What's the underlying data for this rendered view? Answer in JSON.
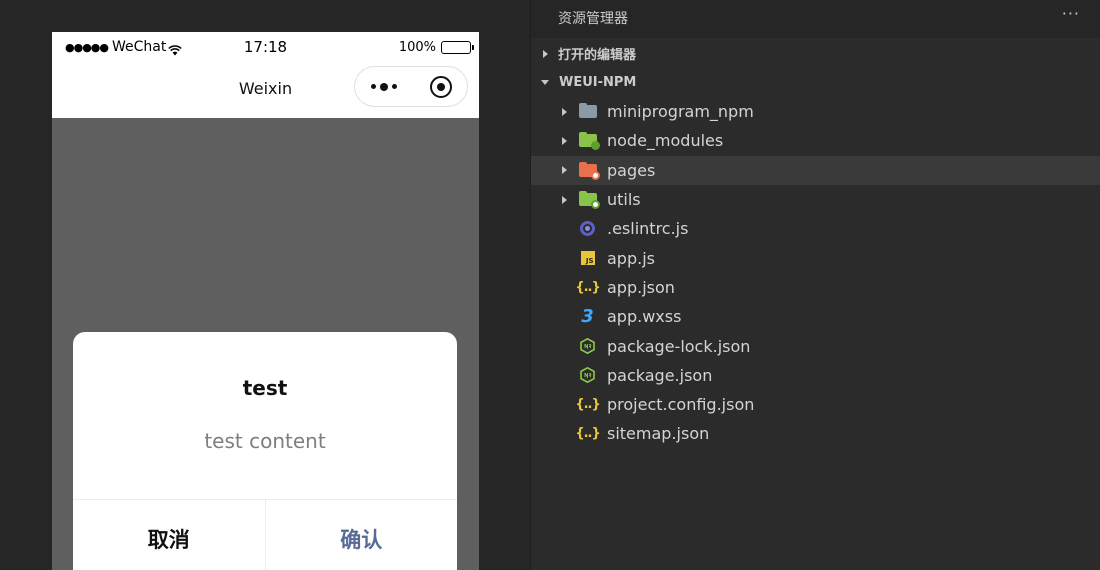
{
  "simulator": {
    "status_bar": {
      "signal_dots": "●●●●●",
      "carrier": "WeChat",
      "time": "17:18",
      "battery_percent": "100%"
    },
    "nav_title": "Weixin",
    "dialog": {
      "title": "test",
      "content": "test content",
      "cancel_label": "取消",
      "confirm_label": "确认"
    }
  },
  "explorer": {
    "title": "资源管理器",
    "more_label": "···",
    "open_editors_label": "打开的编辑器",
    "project_label": "WEUI-NPM",
    "items": [
      {
        "name": "miniprogram_npm",
        "kind": "folder",
        "icon": "folder-gray-icon"
      },
      {
        "name": "node_modules",
        "kind": "folder",
        "icon": "folder-node-icon"
      },
      {
        "name": "pages",
        "kind": "folder",
        "icon": "folder-pages-icon"
      },
      {
        "name": "utils",
        "kind": "folder",
        "icon": "folder-utils-icon"
      },
      {
        "name": ".eslintrc.js",
        "kind": "file",
        "icon": "eslint-icon"
      },
      {
        "name": "app.js",
        "kind": "file",
        "icon": "js-file-icon"
      },
      {
        "name": "app.json",
        "kind": "file",
        "icon": "json-file-icon"
      },
      {
        "name": "app.wxss",
        "kind": "file",
        "icon": "css-file-icon"
      },
      {
        "name": "package-lock.json",
        "kind": "file",
        "icon": "nodejs-file-icon"
      },
      {
        "name": "package.json",
        "kind": "file",
        "icon": "nodejs-file-icon"
      },
      {
        "name": "project.config.json",
        "kind": "file",
        "icon": "json-file-icon"
      },
      {
        "name": "sitemap.json",
        "kind": "file",
        "icon": "json-file-icon"
      }
    ],
    "selected_item": "pages"
  },
  "colors": {
    "dialog_confirm": "#576b95",
    "explorer_bg": "#2b2b2b",
    "mask": "#5f5f5f"
  }
}
